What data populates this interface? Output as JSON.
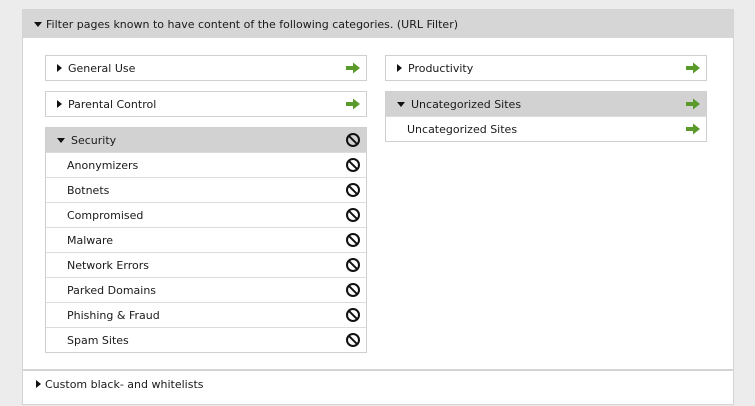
{
  "header": {
    "title": "Filter pages known to have content of the following categories. (URL Filter)"
  },
  "left_column": [
    {
      "label": "General Use",
      "state": "collapsed",
      "action": "allow-arrow-icon"
    },
    {
      "label": "Parental Control",
      "state": "collapsed",
      "action": "allow-arrow-icon"
    },
    {
      "label": "Security",
      "state": "expanded",
      "action": "block-icon",
      "items": [
        {
          "label": "Anonymizers",
          "action": "block-icon"
        },
        {
          "label": "Botnets",
          "action": "block-icon"
        },
        {
          "label": "Compromised",
          "action": "block-icon"
        },
        {
          "label": "Malware",
          "action": "block-icon"
        },
        {
          "label": "Network Errors",
          "action": "block-icon"
        },
        {
          "label": "Parked Domains",
          "action": "block-icon"
        },
        {
          "label": "Phishing & Fraud",
          "action": "block-icon"
        },
        {
          "label": "Spam Sites",
          "action": "block-icon"
        }
      ]
    }
  ],
  "right_column": [
    {
      "label": "Productivity",
      "state": "collapsed",
      "action": "allow-arrow-icon"
    },
    {
      "label": "Uncategorized Sites",
      "state": "expanded",
      "action": "allow-arrow-icon",
      "items": [
        {
          "label": "Uncategorized Sites",
          "action": "allow-arrow-icon"
        }
      ]
    }
  ],
  "footer": {
    "label": "Custom black- and whitelists"
  },
  "colors": {
    "allow": "#5a9a2a",
    "block": "#111111",
    "header_bg": "#d6d6d6"
  }
}
